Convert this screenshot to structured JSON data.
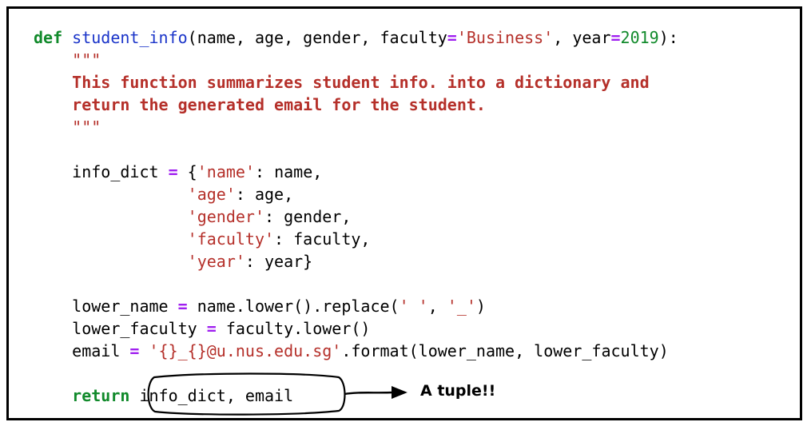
{
  "code": {
    "def_kw": "def",
    "func_name": "student_info",
    "params_open": "(name, age, gender, faculty",
    "eq": "=",
    "default_faculty": "'Business'",
    "comma_year": ", year",
    "default_year": "2019",
    "params_close": "):",
    "doc_quote_open": "\"\"\"",
    "doc_line1": "This function summarizes student info. into a dictionary and",
    "doc_line2": "return the generated email for the student.",
    "doc_quote_close": "\"\"\"",
    "dict_var": "info_dict ",
    "dict_open": " {",
    "key_name": "'name'",
    "val_name": ": name,",
    "key_age": "'age'",
    "val_age": ": age,",
    "key_gender": "'gender'",
    "val_gender": ": gender,",
    "key_faculty": "'faculty'",
    "val_faculty": ": faculty,",
    "key_year": "'year'",
    "val_year": ": year}",
    "lower_name_var": "lower_name ",
    "lower_name_expr_a": " name.lower().replace(",
    "space_str": "' '",
    "sep_comma": ", ",
    "underscore_str": "'_'",
    "close_paren": ")",
    "lower_faculty_var": "lower_faculty ",
    "lower_faculty_expr": " faculty.lower()",
    "email_var": "email ",
    "email_fmt": "'{}_{}@u.nus.edu.sg'",
    "email_call": ".format(lower_name, lower_faculty)",
    "return_kw": "return",
    "return_expr": "info_dict, email"
  },
  "annotation": {
    "note": "A tuple!!"
  }
}
